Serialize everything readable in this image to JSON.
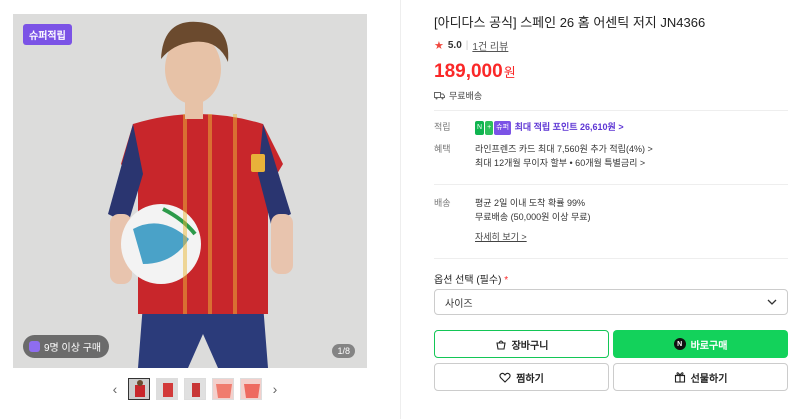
{
  "gallery": {
    "badge_top": "슈퍼적립",
    "badge_bottom": "9명 이상 구매",
    "counter": "1/8"
  },
  "product": {
    "title": "[아디다스 공식] 스페인 26 홈 어센틱 저지 JN4366",
    "rating": "5.0",
    "reviews": "1건 리뷰",
    "price": "189,000",
    "currency": "원",
    "shipping": "무료배송"
  },
  "details": {
    "points_label": "적립",
    "points_text": "최대 적립 포인트 26,610원 >",
    "benefit_label": "혜택",
    "benefit_line1": "라인프렌즈 카드 최대 7,560원 추가 적립(4%) >",
    "benefit_line2": "최대 12개월 무이자 할부 • 60개월 특별금리 >",
    "delivery_label": "배송",
    "delivery_line1": "평균 2일 이내 도착 확률 99%",
    "delivery_line2": "무료배송 (50,000원 이상 무료)",
    "more": "자세히 보기 >"
  },
  "options": {
    "label": "옵션 선택 (필수)",
    "required_mark": "*",
    "select_value": "사이즈"
  },
  "buttons": {
    "cart": "장바구니",
    "buy": "바로구매",
    "like": "찜하기",
    "gift": "선물하기"
  },
  "colors": {
    "accent_green": "#13d25b",
    "price_red": "#fa2828",
    "purple": "#7b53e6"
  }
}
